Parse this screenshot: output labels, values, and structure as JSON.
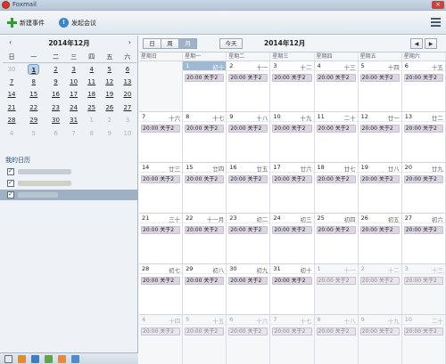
{
  "window": {
    "title": "Foxmail"
  },
  "toolbar": {
    "new_event": "新建事件",
    "meeting": "发起会议"
  },
  "mini_calendar": {
    "title": "2014年12月",
    "weekdays": [
      "日",
      "一",
      "二",
      "三",
      "四",
      "五",
      "六"
    ],
    "weeks": [
      [
        "30",
        "1",
        "2",
        "3",
        "4",
        "5",
        "6"
      ],
      [
        "7",
        "8",
        "9",
        "10",
        "11",
        "12",
        "13"
      ],
      [
        "14",
        "15",
        "16",
        "17",
        "18",
        "19",
        "20"
      ],
      [
        "21",
        "22",
        "23",
        "24",
        "25",
        "26",
        "27"
      ],
      [
        "28",
        "29",
        "30",
        "31",
        "1",
        "2",
        "3"
      ],
      [
        "4",
        "5",
        "6",
        "7",
        "8",
        "9",
        "10"
      ]
    ]
  },
  "my_calendars": {
    "title": "我的日历"
  },
  "main": {
    "views": [
      "日",
      "周",
      "月"
    ],
    "active_view": "月",
    "today_label": "今天",
    "month_title": "2014年12月",
    "weekday_headers": [
      "星期日",
      "星期一",
      "星期二",
      "星期三",
      "星期四",
      "星期五",
      "星期六"
    ],
    "weeks": [
      [
        {
          "d": "",
          "l": "",
          "ev": ""
        },
        {
          "d": "1",
          "l": "初十",
          "ev": "20:00 关于2"
        },
        {
          "d": "2",
          "l": "十一",
          "ev": "20:00 关于2"
        },
        {
          "d": "3",
          "l": "十二",
          "ev": "20:00 关于2"
        },
        {
          "d": "4",
          "l": "十三",
          "ev": "20:00 关于2"
        },
        {
          "d": "5",
          "l": "十四",
          "ev": "20:00 关于2"
        },
        {
          "d": "6",
          "l": "十五",
          "ev": "20:00 关于2"
        }
      ],
      [
        {
          "d": "7",
          "l": "十六",
          "ev": "20:00 关于2"
        },
        {
          "d": "8",
          "l": "十七",
          "ev": "20:00 关于2"
        },
        {
          "d": "9",
          "l": "十八",
          "ev": "20:00 关于2"
        },
        {
          "d": "10",
          "l": "十九",
          "ev": "20:00 关于2"
        },
        {
          "d": "11",
          "l": "二十",
          "ev": "20:00 关于2"
        },
        {
          "d": "12",
          "l": "廿一",
          "ev": "20:00 关于2"
        },
        {
          "d": "13",
          "l": "廿二",
          "ev": "20:00 关于2"
        }
      ],
      [
        {
          "d": "14",
          "l": "廿三",
          "ev": "20:00 关于2"
        },
        {
          "d": "15",
          "l": "廿四",
          "ev": "20:00 关于2"
        },
        {
          "d": "16",
          "l": "廿五",
          "ev": "20:00 关于2"
        },
        {
          "d": "17",
          "l": "廿六",
          "ev": "20:00 关于2"
        },
        {
          "d": "18",
          "l": "廿七",
          "ev": "20:00 关于2"
        },
        {
          "d": "19",
          "l": "廿八",
          "ev": "20:00 关于2"
        },
        {
          "d": "20",
          "l": "廿九",
          "ev": "20:00 关于2"
        }
      ],
      [
        {
          "d": "21",
          "l": "三十",
          "ev": "20:00 关于2"
        },
        {
          "d": "22",
          "l": "十一月",
          "ev": "20:00 关于2"
        },
        {
          "d": "23",
          "l": "初二",
          "ev": "20:00 关于2"
        },
        {
          "d": "24",
          "l": "初三",
          "ev": "20:00 关于2"
        },
        {
          "d": "25",
          "l": "初四",
          "ev": "20:00 关于2"
        },
        {
          "d": "26",
          "l": "初五",
          "ev": "20:00 关于2"
        },
        {
          "d": "27",
          "l": "初六",
          "ev": "20:00 关于2"
        }
      ],
      [
        {
          "d": "28",
          "l": "初七",
          "ev": "20:00 关于2"
        },
        {
          "d": "29",
          "l": "初八",
          "ev": "20:00 关于2"
        },
        {
          "d": "30",
          "l": "初九",
          "ev": "20:00 关于2"
        },
        {
          "d": "31",
          "l": "初十",
          "ev": "20:00 关于2"
        },
        {
          "d": "1",
          "l": "十一",
          "ev": "20:00 关于2"
        },
        {
          "d": "2",
          "l": "十二",
          "ev": "20:00 关于2"
        },
        {
          "d": "3",
          "l": "十三",
          "ev": "20:00 关于2"
        }
      ],
      [
        {
          "d": "4",
          "l": "十四",
          "ev": "20:00 关于2"
        },
        {
          "d": "5",
          "l": "十五",
          "ev": "20:00 关于2"
        },
        {
          "d": "6",
          "l": "十六",
          "ev": "20:00 关于2"
        },
        {
          "d": "7",
          "l": "十七",
          "ev": "20:00 关于2"
        },
        {
          "d": "8",
          "l": "十八",
          "ev": "20:00 关于2"
        },
        {
          "d": "9",
          "l": "十九",
          "ev": "20:00 关于2"
        },
        {
          "d": "10",
          "l": "二十",
          "ev": "20:00 关于2"
        }
      ]
    ]
  },
  "colors": {
    "toolbar_bg": "#dfe7ef",
    "selected_calendar": "#9fb0c2",
    "event_bg": "#dcd6e3"
  }
}
